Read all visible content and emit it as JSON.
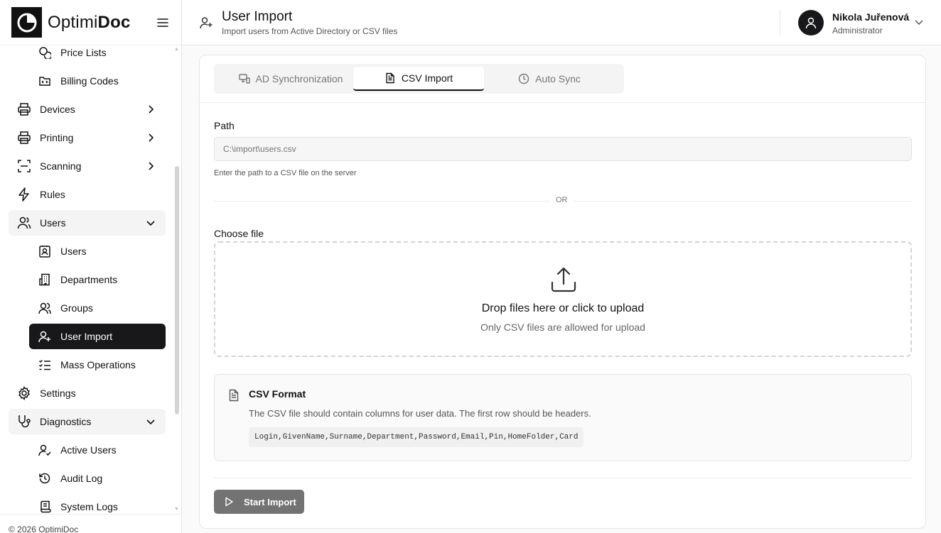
{
  "logo": {
    "prefix": "Optimi",
    "suffix": "Doc"
  },
  "sidebar": {
    "items": [
      {
        "label": "Price Lists",
        "icon": "coins-icon"
      },
      {
        "label": "Billing Codes",
        "icon": "folder-code-icon"
      },
      {
        "label": "Devices",
        "icon": "printer-icon"
      },
      {
        "label": "Printing",
        "icon": "printer-icon"
      },
      {
        "label": "Scanning",
        "icon": "scan-icon"
      },
      {
        "label": "Rules",
        "icon": "lightning-icon"
      },
      {
        "label": "Users",
        "icon": "users-icon"
      },
      {
        "label": "Users",
        "icon": "contact-icon"
      },
      {
        "label": "Departments",
        "icon": "building-icon"
      },
      {
        "label": "Groups",
        "icon": "group-icon"
      },
      {
        "label": "User Import",
        "icon": "user-plus-icon"
      },
      {
        "label": "Mass Operations",
        "icon": "list-checks-icon"
      },
      {
        "label": "Settings",
        "icon": "gear-icon"
      },
      {
        "label": "Diagnostics",
        "icon": "stethoscope-icon"
      },
      {
        "label": "Active Users",
        "icon": "user-check-icon"
      },
      {
        "label": "Audit Log",
        "icon": "history-icon"
      },
      {
        "label": "System Logs",
        "icon": "scroll-icon"
      }
    ]
  },
  "footer": "© 2026 OptimiDoc",
  "header": {
    "title": "User Import",
    "subtitle": "Import users from Active Directory or CSV files"
  },
  "user": {
    "name": "Nikola Juřenová",
    "role": "Administrator"
  },
  "tabs": [
    {
      "label": "AD Synchronization",
      "icon": "network-icon"
    },
    {
      "label": "CSV Import",
      "icon": "file-text-icon",
      "active": true
    },
    {
      "label": "Auto Sync",
      "icon": "clock-icon"
    }
  ],
  "form": {
    "path_label": "Path",
    "path_placeholder": "C:\\import\\users.csv",
    "path_hint": "Enter the path to a CSV file on the server",
    "or": "OR",
    "file_label": "Choose file",
    "drop_title": "Drop files here or click to upload",
    "drop_sub": "Only CSV files are allowed for upload"
  },
  "csv_format": {
    "title": "CSV Format",
    "description": "The CSV file should contain columns for user data. The first row should be headers.",
    "columns": "Login,GivenName,Surname,Department,Password,Email,Pin,HomeFolder,Card"
  },
  "actions": {
    "start": "Start Import"
  },
  "colors": {
    "active_nav": "#18181b",
    "button_disabled": "#737373"
  }
}
